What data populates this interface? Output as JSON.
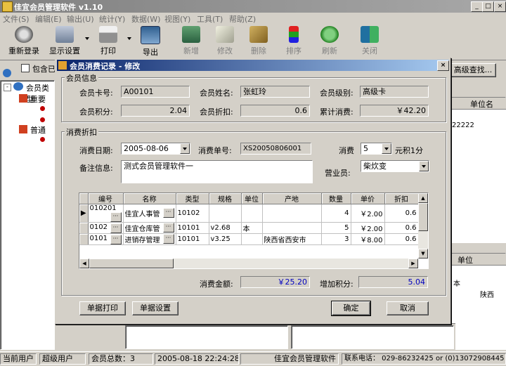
{
  "app": {
    "title": "佳宜会员管理软件 v1.10"
  },
  "menu": [
    "文件(S)",
    "编辑(E)",
    "输出(U)",
    "统计(Y)",
    "数据(W)",
    "视图(Y)",
    "工具(T)",
    "帮助(Z)"
  ],
  "toolbar": {
    "relogin": "重新登录",
    "display": "显示设置",
    "print": "打印",
    "export": "导出",
    "add": "新增",
    "edit": "修改",
    "delete": "删除",
    "sort": "排序",
    "refresh": "刷新",
    "close": "关闭"
  },
  "background": {
    "include_label": "包含已",
    "tree": [
      "会员类型",
      "重要",
      "普通"
    ],
    "adv_search": "高级查找...",
    "col_unit": "单位名",
    "col_unit2": "单位",
    "val_22222": "22222",
    "val_ben": "本",
    "val_shaanxi": "陕西"
  },
  "dialog": {
    "title": "会员消费记录 - 修改",
    "member_group": "会员信息",
    "card_label": "会员卡号:",
    "card_value": "A00101",
    "name_label": "会员姓名:",
    "name_value": "张虹玲",
    "level_label": "会员级别:",
    "level_value": "高级卡",
    "points_label": "会员积分:",
    "points_value": "2.04",
    "discount_label": "会员折扣:",
    "discount_value": "0.6",
    "total_label": "累计消费:",
    "total_value": "￥42.20",
    "consume_group": "消费折扣",
    "date_label": "消费日期:",
    "date_value": "2005-08-06",
    "order_label": "消费单号:",
    "order_value": "XS20050806001",
    "consume_label": "消费",
    "consume_value": "5",
    "consume_unit": "元积1分",
    "note_label": "备注信息:",
    "note_value": "测式会员管理软件一",
    "clerk_label": "营业员:",
    "clerk_value": "柴炊变",
    "amount_label": "消费金额:",
    "amount_value": "￥25.20",
    "addpts_label": "增加积分:",
    "addpts_value": "5.04",
    "btn_print": "单据打印",
    "btn_settings": "单据设置",
    "btn_ok": "确定",
    "btn_cancel": "取消"
  },
  "grid": {
    "headers": [
      "编号",
      "名称",
      "类型",
      "规格",
      "单位",
      "产地",
      "数量",
      "单价",
      "折扣"
    ],
    "rows": [
      [
        "010201",
        "佳宜人事管",
        "10102",
        "",
        "",
        "",
        "4",
        "￥2.00",
        "0.6"
      ],
      [
        "0102",
        "佳宜仓库管",
        "10101",
        "v2.68",
        "本",
        "",
        "5",
        "￥2.00",
        "0.6"
      ],
      [
        "0101",
        "进销存管理",
        "10101",
        "v3.25",
        "",
        "陕西省西安市",
        "3",
        "￥8.00",
        "0.6"
      ]
    ]
  },
  "statusbar": {
    "current_user_label": "当前用户",
    "current_user": "超级用户",
    "member_count": "会员总数：3",
    "datetime": "2005-08-18 22:24:28",
    "app_name": "佳宜会员管理软件",
    "phone": "联系电话： 029-86232425 or (0)13072908445"
  },
  "colors": {
    "title_active": "#0a246a",
    "title_inactive": "#808080",
    "value_blue": "#0000c0"
  }
}
